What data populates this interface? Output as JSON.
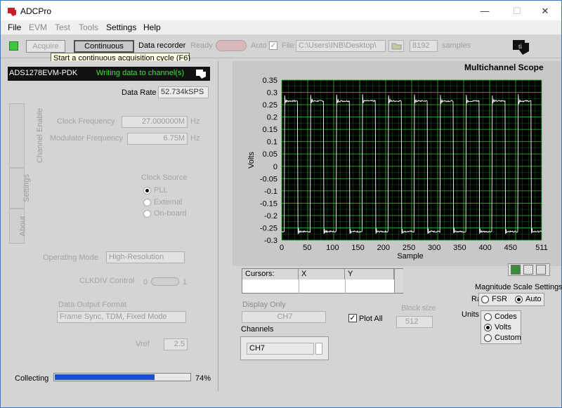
{
  "window": {
    "title": "ADCPro",
    "minimize": "—",
    "maximize": "☐",
    "close": "✕"
  },
  "menu": {
    "items": [
      {
        "label": "File",
        "enabled": true
      },
      {
        "label": "EVM",
        "enabled": false
      },
      {
        "label": "Test",
        "enabled": false
      },
      {
        "label": "Tools",
        "enabled": false
      },
      {
        "label": "Settings",
        "enabled": true
      },
      {
        "label": "Help",
        "enabled": true
      }
    ]
  },
  "toolbar": {
    "acquire_label": "Acquire",
    "continuous_label": "Continuous",
    "data_recorder_label": "Data recorder",
    "ready_label": "Ready",
    "auto_label": "Auto",
    "file_label": "File",
    "file_path": "C:\\Users\\INB\\Desktop\\",
    "samples_value": "8192",
    "samples_label": "samples",
    "tooltip": "Start a continuous acquisition cycle (F6)"
  },
  "evm": {
    "name": "ADS1278EVM-PDK",
    "status": "Writing data to channel(s)",
    "data_rate_label": "Data Rate",
    "data_rate_value": "52.734kSPS",
    "tabs": [
      "Channel Enable",
      "Settings",
      "About"
    ],
    "clock_frequency_label": "Clock Frequency",
    "clock_frequency_value": "27.000000M",
    "clock_frequency_unit": "Hz",
    "modulator_frequency_label": "Modulator Frequency",
    "modulator_frequency_value": "6.75M",
    "modulator_frequency_unit": "Hz",
    "clock_source_label": "Clock Source",
    "clock_source_options": [
      "PLL",
      "External",
      "On-board"
    ],
    "operating_mode_label": "Operating Mode",
    "operating_mode_value": "High-Resolution",
    "clkdiv_label": "CLKDIV Control",
    "clkdiv_low": "0",
    "clkdiv_high": "1",
    "data_output_format_label": "Data Output Format",
    "data_output_format_value": "Frame Sync, TDM, Fixed Mode",
    "vref_label": "Vref",
    "vref_value": "2.5",
    "collecting_label": "Collecting",
    "progress_percent_text": "74%",
    "progress_fraction": 0.74
  },
  "scope": {
    "title": "Multichannel Scope",
    "cursors_header": "Cursors:",
    "x_header": "X",
    "y_header": "Y",
    "display_only_label": "Display Only",
    "display_only_value": "CH7",
    "plot_all_label": "Plot All",
    "plot_all_checked": true,
    "block_size_label": "Block size",
    "block_size_value": "512",
    "channels_label": "Channels",
    "channel_value": "CH7",
    "magnitude_title": "Magnitude Scale Settings",
    "range_label": "Range",
    "range_options": [
      {
        "label": "FSR",
        "selected": false
      },
      {
        "label": "Auto",
        "selected": true
      }
    ],
    "units_label": "Units",
    "units_options": [
      {
        "label": "Codes",
        "selected": false
      },
      {
        "label": "Volts",
        "selected": true
      },
      {
        "label": "Custom",
        "selected": false
      }
    ],
    "colors": {
      "plot_bg": "#000000",
      "grid": "#2fb82f",
      "trace": "#ffffff"
    }
  },
  "chart_data": {
    "type": "line",
    "xlabel": "Sample",
    "ylabel": "Volts",
    "xlim": [
      0,
      511
    ],
    "ylim": [
      -0.3,
      0.35
    ],
    "xticks": [
      "0",
      "50",
      "100",
      "150",
      "200",
      "250",
      "300",
      "350",
      "400",
      "450",
      "511"
    ],
    "yticks": [
      "0.35",
      "0.3",
      "0.25",
      "0.2",
      "0.15",
      "0.1",
      "0.05",
      "0",
      "-0.05",
      "-0.1",
      "-0.15",
      "-0.2",
      "-0.25",
      "-0.3"
    ],
    "series": [
      {
        "high": 0.265,
        "low": -0.265,
        "period_samples": 51,
        "first_rise_sample": 6,
        "duty": 0.5
      }
    ]
  }
}
